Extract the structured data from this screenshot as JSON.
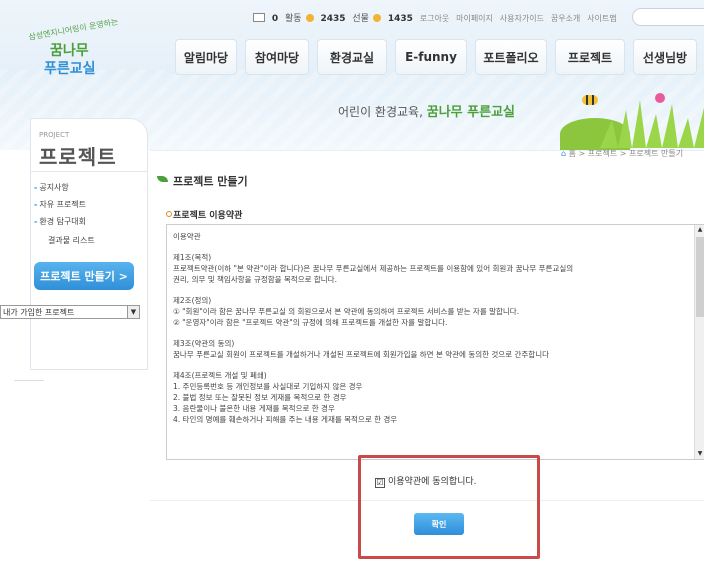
{
  "header": {
    "logo": {
      "small": "삼성엔지니어링이 운영하는",
      "line1": "꿈나무",
      "line2": "푸른교실"
    },
    "util": {
      "msg_count": "0",
      "activity_label": "활동",
      "activity_value": "2435",
      "gift_label": "선물",
      "gift_value": "1435",
      "links": [
        "로그아웃",
        "마이페이지",
        "사용자가이드",
        "꿈우소개",
        "사이트맵"
      ]
    },
    "nav": [
      "알림마당",
      "참여마당",
      "환경교실",
      "E-funny",
      "포트폴리오",
      "프로젝트",
      "선생님방"
    ],
    "tagline_prefix": "어린이 환경교육,",
    "tagline_brand": "꿈나무 푸른교실"
  },
  "sidebar": {
    "sub": "PROJECT",
    "title": "프로젝트",
    "items": [
      "공지사항",
      "자유 프로젝트",
      "환경 탐구대회"
    ],
    "subitem": "결과물 리스트",
    "make_button": "프로젝트 만들기 >",
    "select_value": "내가 가입한 프로젝트"
  },
  "breadcrumb": {
    "home": "홈",
    "sep": ">",
    "level1": "프로젝트",
    "level2": "프로젝트 만들기"
  },
  "main": {
    "page_title": "프로젝트 만들기",
    "section_title": "프로젝트 이용약관",
    "terms": [
      "이용약관",
      "제1조(목적)\n프로젝트약관(이하 \"본 약관\"이라 합니다)은 꿈나무 푸른교실에서 제공하는 프로젝트를 이용함에 있어 회원과 꿈나무 푸른교실의\n권리, 의무 및 책임사항을 규정함을 목적으로 합니다.",
      "제2조(정의)\n① \"회원\"이라 함은 꿈나무 푸른교실 의 회원으로서 본 약관에 동의하여 프로젝트 서비스를 받는 자를 말합니다.\n② \"운영자\"이라 함은 \"프로젝트 약관\"의 규정에 의해 프로젝트를 개설한 자를 말합니다.",
      "제3조(약관의 동의)\n꿈나무 푸른교실 회원이 프로젝트를 개설하거나 개설된 프로젝트에 회원가입을 하면 본 약관에 동의한 것으로 간주합니다",
      "제4조(프로젝트 개설 및 폐쇄)\n1. 주민등록번호 등 개인정보를 사실대로 기입하지 않은 경우\n2. 불법 정보 또는 잘못된 정보 게재를 목적으로 한 경우\n3. 음란물이나 불온한 내용 게재를 목적으로 한 경우\n4. 타인의 명예를 훼손하거나 피해를 주는 내용 게재를 목적으로 한 경우"
    ],
    "agree_label": "이용약관에 동의합니다.",
    "agree_checked": "☑",
    "confirm_label": "확인"
  },
  "colors": {
    "accent_blue": "#2f8fd8",
    "brand_green": "#4aa03a",
    "highlight_red": "#c94a4a"
  }
}
